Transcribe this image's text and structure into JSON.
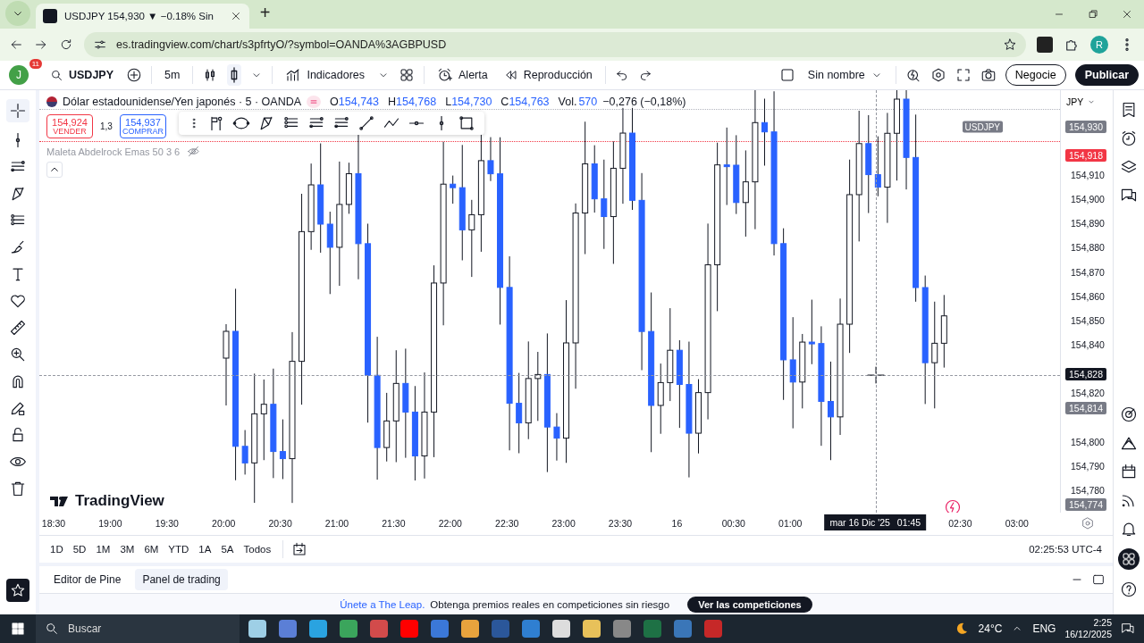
{
  "browser": {
    "tab_title": "USDJPY 154,930 ▼ −0.18% Sin",
    "new_tab": "+",
    "url": "es.tradingview.com/chart/s3pfrtyO/?symbol=OANDA%3AGBPUSD",
    "profile": "R"
  },
  "toolbar": {
    "avatar": "J",
    "badge": "11",
    "symbol": "USDJPY",
    "interval": "5m",
    "indicators": "Indicadores",
    "alert": "Alerta",
    "replay": "Reproducción",
    "layout_name": "Sin nombre",
    "trade_button": "Negocie",
    "publish_button": "Publicar"
  },
  "legend": {
    "title": "Dólar estadounidense/Yen japonés · 5 · OANDA",
    "values": [
      {
        "label": "O",
        "value": "154,743"
      },
      {
        "label": "H",
        "value": "154,768"
      },
      {
        "label": "L",
        "value": "154,730"
      },
      {
        "label": "C",
        "value": "154,763"
      }
    ],
    "volume_label": "Vol.",
    "volume": "570",
    "change": "−0,276 (−0,18%)"
  },
  "order": {
    "sell_price": "154,924",
    "sell_label": "VENDER",
    "spread": "1,3",
    "buy_price": "154,937",
    "buy_label": "COMPRAR"
  },
  "indicator": "Maleta Abdelrock Emas 50 3 6",
  "currency": "JPY",
  "price_axis": {
    "ticks": [
      "154,910",
      "154,900",
      "154,890",
      "154,880",
      "154,870",
      "154,860",
      "154,850",
      "154,840",
      "154,820",
      "154,800",
      "154,790",
      "154,780"
    ],
    "tags": [
      {
        "label": "USDJPY",
        "value": "154,930",
        "color": "#787b86"
      },
      {
        "value": "154,918",
        "color": "#f23645"
      },
      {
        "value": "154,828",
        "color": "#131722"
      },
      {
        "value": "154,814",
        "color": "#787b86"
      },
      {
        "value": "154,774",
        "color": "#787b86"
      }
    ]
  },
  "time_axis": [
    {
      "kind": "tick",
      "label": "18:30"
    },
    {
      "kind": "tick",
      "label": "19:00"
    },
    {
      "kind": "tick",
      "label": "19:30"
    },
    {
      "kind": "tick",
      "label": "20:00"
    },
    {
      "kind": "tick",
      "label": "20:30"
    },
    {
      "kind": "tick",
      "label": "21:00"
    },
    {
      "kind": "tick",
      "label": "21:30"
    },
    {
      "kind": "tick",
      "label": "22:00"
    },
    {
      "kind": "tick",
      "label": "22:30"
    },
    {
      "kind": "tick",
      "label": "23:00"
    },
    {
      "kind": "tick",
      "label": "23:30"
    },
    {
      "kind": "tick",
      "label": "16"
    },
    {
      "kind": "tick",
      "label": "00:30"
    },
    {
      "kind": "tick",
      "label": "01:00"
    },
    {
      "kind": "crosshair",
      "label": "mar 16 Dic '25",
      "time": "01:45"
    },
    {
      "kind": "tick",
      "label": "02:30"
    },
    {
      "kind": "tick",
      "label": "03:00"
    }
  ],
  "logo": "TradingView",
  "ranges": [
    "1D",
    "5D",
    "1M",
    "3M",
    "6M",
    "YTD",
    "1A",
    "5A",
    "Todos"
  ],
  "clock": "02:25:53 UTC-4",
  "panel_tabs": [
    {
      "label": "Editor de Pine",
      "selected": false
    },
    {
      "label": "Panel de trading",
      "selected": true
    }
  ],
  "banner": {
    "link": "Únete a The Leap.",
    "text": "Obtenga premios reales en competiciones sin riesgo",
    "button": "Ver las competiciones"
  },
  "taskbar": {
    "search": "Buscar",
    "weather": "24°C",
    "language": "ENG",
    "time": "2:25",
    "date": "16/12/2025"
  }
}
